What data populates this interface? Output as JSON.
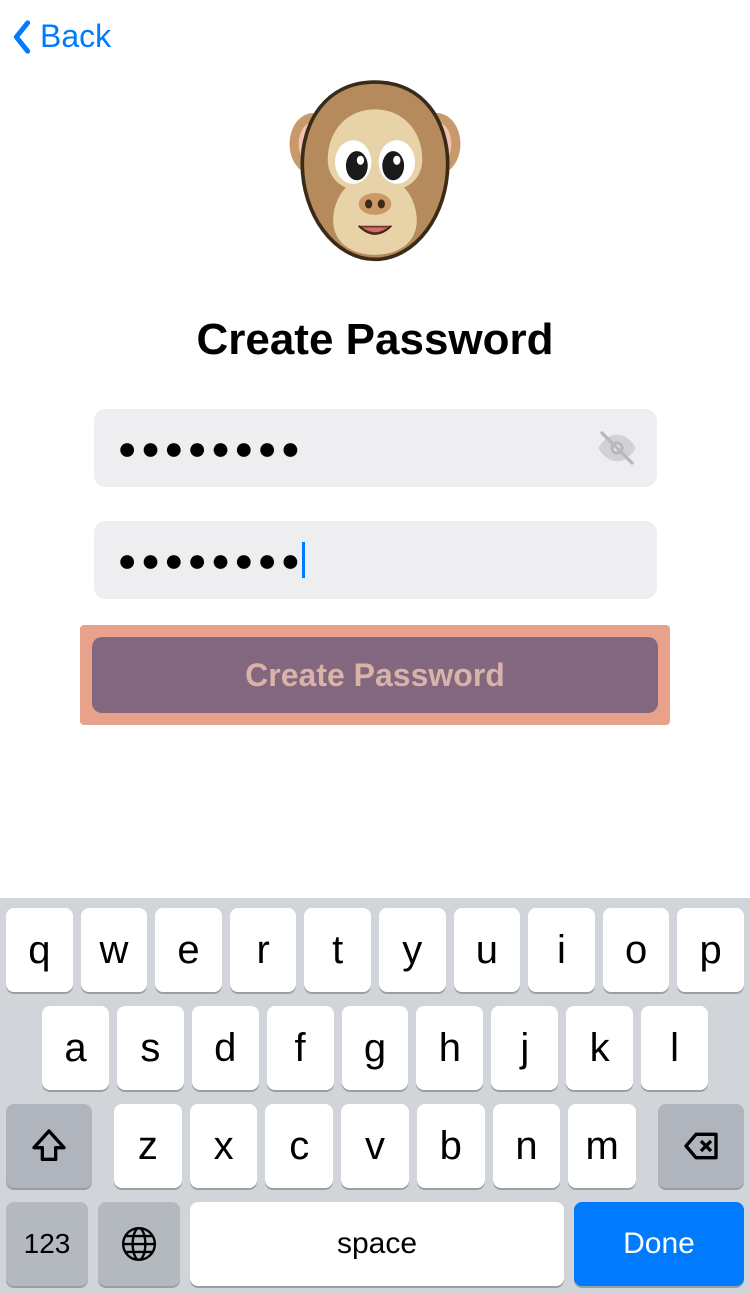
{
  "header": {
    "back_label": "Back"
  },
  "page": {
    "title": "Create Password",
    "password1_masked": "●●●●●●●●",
    "password2_masked": "●●●●●●●●",
    "submit_label": "Create Password"
  },
  "keyboard": {
    "row1": [
      "q",
      "w",
      "e",
      "r",
      "t",
      "y",
      "u",
      "i",
      "o",
      "p"
    ],
    "row2": [
      "a",
      "s",
      "d",
      "f",
      "g",
      "h",
      "j",
      "k",
      "l"
    ],
    "row3": [
      "z",
      "x",
      "c",
      "v",
      "b",
      "n",
      "m"
    ],
    "num_label": "123",
    "space_label": "space",
    "done_label": "Done"
  }
}
